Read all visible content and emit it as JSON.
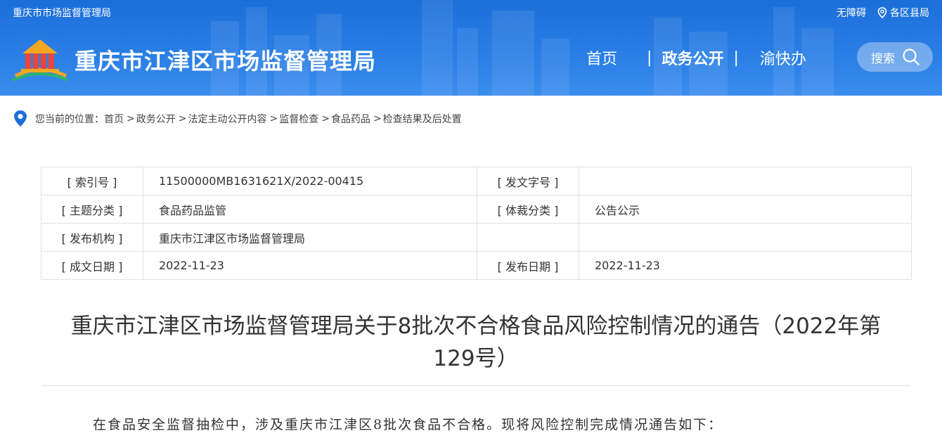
{
  "header": {
    "top_left": "重庆市市场监督管理局",
    "accessibility": "无障碍",
    "districts": "各区县局",
    "site_title": "重庆市江津区市场监督管理局",
    "nav": [
      "首页",
      "政务公开",
      "渝快办"
    ],
    "nav_separator": "|",
    "search_label": "搜索"
  },
  "breadcrumb": {
    "prefix": "您当前的位置：",
    "items": [
      "首页",
      "政务公开",
      "法定主动公开内容",
      "监督检查",
      "食品药品",
      "检查结果及后处置"
    ],
    "arrow": ">"
  },
  "info": {
    "rows": [
      [
        {
          "label": "[ 索引号 ]",
          "value": "11500000MB1631621X/2022-00415"
        },
        {
          "label": "[ 发文字号 ]",
          "value": ""
        }
      ],
      [
        {
          "label": "[ 主题分类 ]",
          "value": "食品药品监管"
        },
        {
          "label": "[ 体裁分类 ]",
          "value": "公告公示"
        }
      ],
      [
        {
          "label": "[ 发布机构 ]",
          "value": "重庆市江津区市场监督管理局"
        },
        {
          "label": "",
          "value": ""
        }
      ],
      [
        {
          "label": "[ 成文日期 ]",
          "value": "2022-11-23"
        },
        {
          "label": "[ 发布日期 ]",
          "value": "2022-11-23"
        }
      ]
    ]
  },
  "article": {
    "title_line1": "重庆市江津区市场监督管理局关于8批次不合格食品风险控制情况的通告（2022年第",
    "title_line2": "129号）",
    "paragraph1": "在食品安全监督抽检中，涉及重庆市江津区8批次食品不合格。现将风险控制完成情况通告如下："
  }
}
